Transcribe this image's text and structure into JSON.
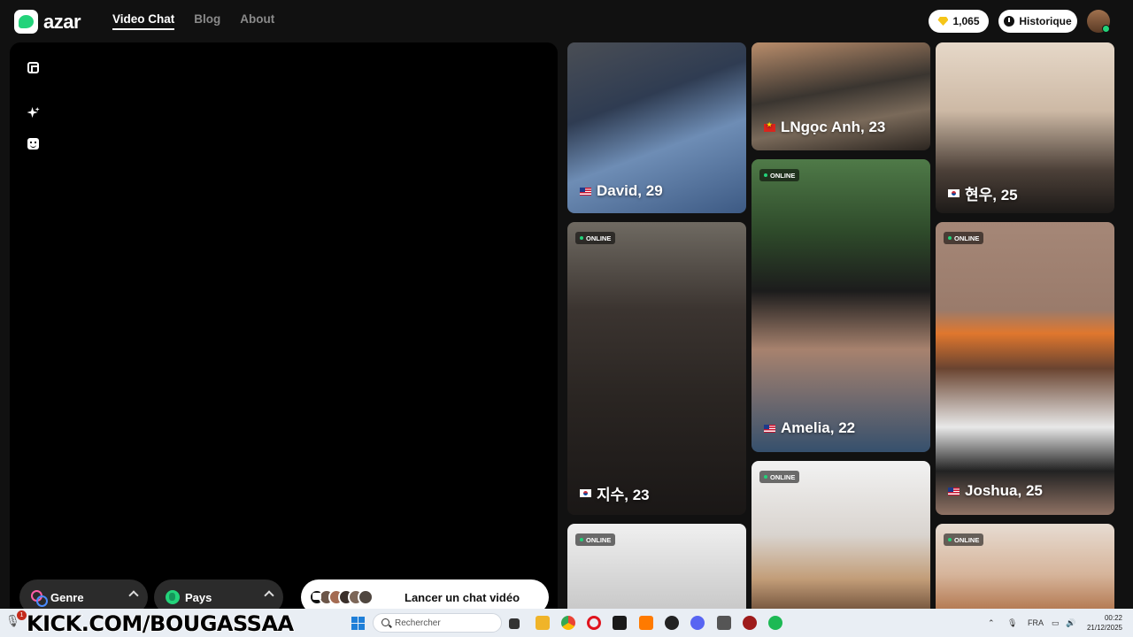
{
  "header": {
    "logo_text": "azar",
    "nav": [
      {
        "label": "Video Chat",
        "active": true
      },
      {
        "label": "Blog",
        "active": false
      },
      {
        "label": "About",
        "active": false
      }
    ],
    "gems": "1,065",
    "history_label": "Historique"
  },
  "video_panel": {
    "side_icons": [
      "expand-icon",
      "sparkle-icon",
      "face-icon"
    ],
    "filters": {
      "gender_label": "Genre",
      "country_label": "Pays"
    },
    "launch_label": "Lancer un chat vidéo"
  },
  "cards": [
    {
      "name": "David, 29",
      "flag": "us",
      "online_label": ""
    },
    {
      "name": "LNgọc Anh, 23",
      "flag": "vn",
      "online_label": ""
    },
    {
      "name": "현우, 25",
      "flag": "kr",
      "online_label": ""
    },
    {
      "name": "지수, 23",
      "flag": "kr",
      "online_label": "ONLINE"
    },
    {
      "name": "Amelia, 22",
      "flag": "us",
      "online_label": "ONLINE"
    },
    {
      "name": "Joshua, 25",
      "flag": "us",
      "online_label": "ONLINE"
    },
    {
      "name": "",
      "flag": "",
      "online_label": "ONLINE"
    },
    {
      "name": "",
      "flag": "",
      "online_label": "ONLINE"
    },
    {
      "name": "",
      "flag": "",
      "online_label": "ONLINE"
    }
  ],
  "taskbar": {
    "banner_text": "KICK.COM/BOUGASSAA",
    "notification_count": "1",
    "search_placeholder": "Rechercher",
    "language": "FRA",
    "time": "00:22",
    "date": "21/12/2025"
  },
  "colors": {
    "accent": "#23d37a",
    "background": "#111111",
    "kick_green": "#53fc18"
  }
}
